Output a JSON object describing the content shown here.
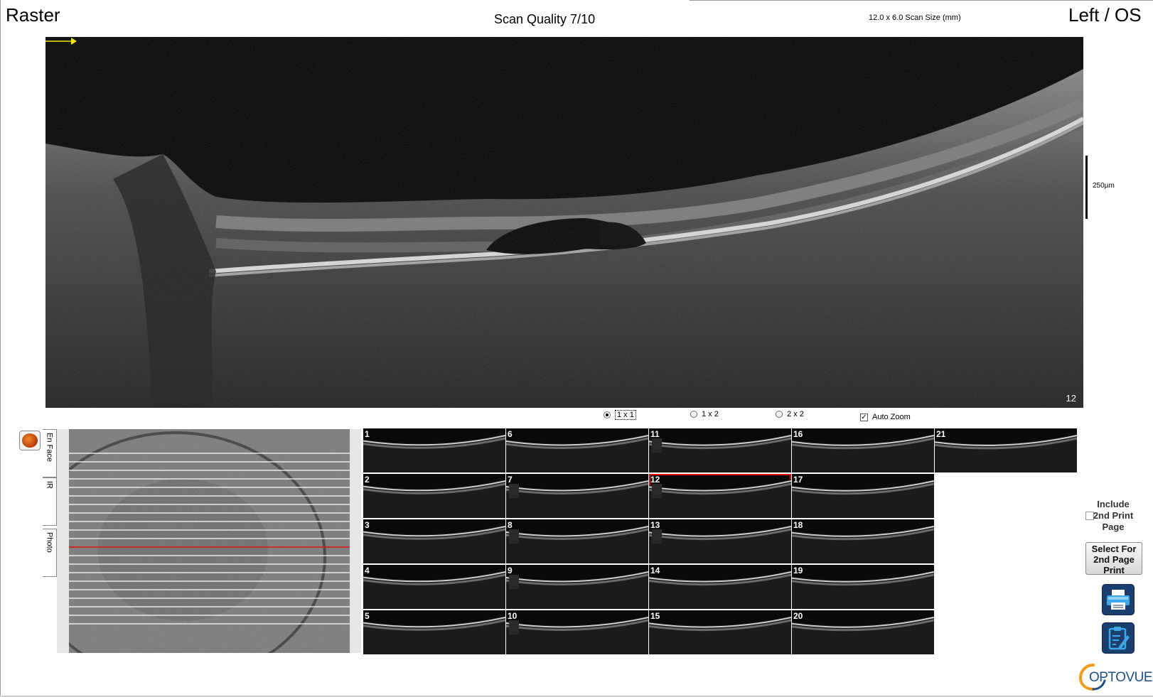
{
  "header": {
    "mode": "Raster",
    "scan_quality": "Scan Quality 7/10",
    "scan_size": "12.0 x 6.0 Scan Size (mm)",
    "eye": "Left / OS"
  },
  "main_scan": {
    "slice_number": "12",
    "scale_label": "250µm",
    "arrow_color": "#f5e20a"
  },
  "layout_options": {
    "opt_1x1": "1 x 1",
    "opt_1x2": "1 x 2",
    "opt_2x2": "2 x 2",
    "selected": "1 x 1",
    "auto_zoom_label": "Auto Zoom",
    "auto_zoom_checked": true
  },
  "side_tabs": {
    "en_face": "En Face",
    "ir": "IR",
    "photo": "Photo"
  },
  "thumbnails": {
    "selected": "12",
    "columns": [
      [
        "1",
        "2",
        "3",
        "4",
        "5"
      ],
      [
        "6",
        "7",
        "8",
        "9",
        "10"
      ],
      [
        "11",
        "12",
        "13",
        "14",
        "15"
      ],
      [
        "16",
        "17",
        "18",
        "19",
        "20"
      ],
      [
        "21"
      ]
    ],
    "selected_color": "#e01010"
  },
  "print_panel": {
    "include_label": "Include 2nd Print Page",
    "include_label_line1": "Include",
    "include_label_line2": "2nd Print",
    "include_label_line3": "Page",
    "select_line1": "Select For",
    "select_line2": "2nd Page",
    "select_line3": "Print",
    "print_icon": "printer-icon",
    "report_icon": "clipboard-edit-icon"
  },
  "brand": {
    "name": "OPTOVUE",
    "color": "#1c4f8a",
    "accent": "#f29a1a"
  }
}
